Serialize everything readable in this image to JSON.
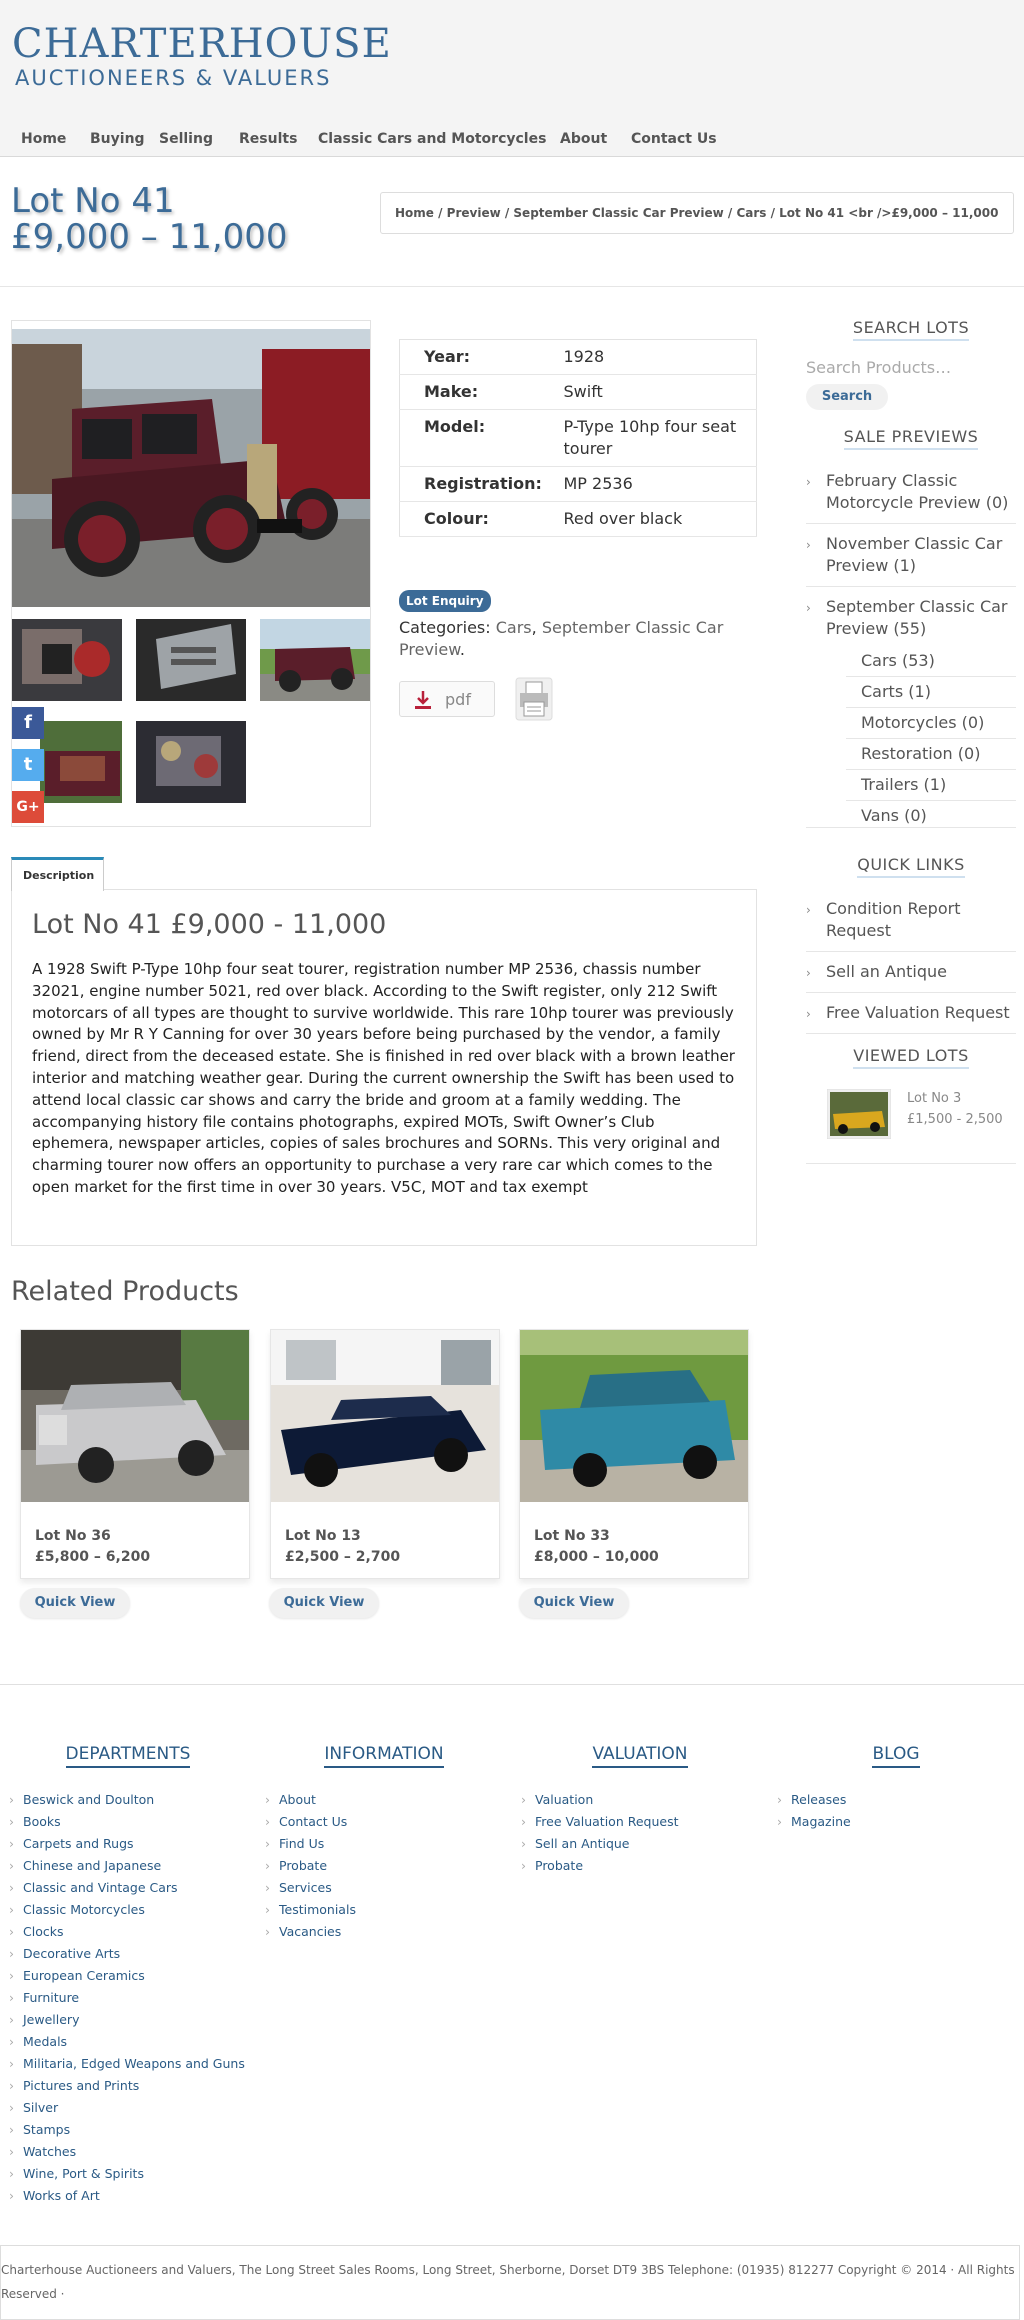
{
  "site": {
    "logo_line1": "CHARTERHOUSE",
    "logo_line2": "AUCTIONEERS & VALUERS",
    "brand_color": "#3c6b97"
  },
  "nav": [
    "Home",
    "Buying",
    "Selling",
    "Results",
    "Classic Cars and Motorcycles",
    "About",
    "Contact Us"
  ],
  "page": {
    "title_line1": "Lot No 41",
    "title_line2": "£9,000 – 11,000",
    "breadcrumb": "Home / Preview / September Classic Car Preview / Cars / Lot No 41 <br />£9,000 – 11,000"
  },
  "social": [
    {
      "icon": "facebook-icon",
      "glyph": "f",
      "color": "#3b5998"
    },
    {
      "icon": "twitter-icon",
      "glyph": "t",
      "color": "#55acee"
    },
    {
      "icon": "google-plus-icon",
      "glyph": "G+",
      "color": "#dd4b39"
    }
  ],
  "specs": [
    {
      "key": "Year:",
      "value": "1928"
    },
    {
      "key": "Make:",
      "value": "Swift"
    },
    {
      "key": "Model:",
      "value": "P-Type 10hp four seat tourer"
    },
    {
      "key": "Registration:",
      "value": "MP 2536"
    },
    {
      "key": "Colour:",
      "value": "Red over black"
    }
  ],
  "enquiry_label": "Lot Enquiry",
  "categories": {
    "label": "Categories:",
    "link1": "Cars",
    "separator": ",",
    "link2": "September Classic Car Preview",
    "end": "."
  },
  "pdf_label": "pdf",
  "description": {
    "tab_label": "Description",
    "heading": "Lot No 41 £9,000 - 11,000",
    "text": "A 1928 Swift P-Type 10hp four seat tourer, registration number MP 2536, chassis number 32021, engine number 5021, red over black. According to the Swift register, only 212 Swift motorcars of all types are thought to survive worldwide. This rare 10hp tourer was previously owned by Mr R Y Canning for over 30 years before being purchased by the vendor, a family friend, direct from the deceased estate. She is finished in red over black with a brown leather interior and matching weather gear. During the current ownership the Swift has been used to attend local classic car shows and carry the bride and groom at a family wedding. The accompanying history file contains photographs, expired MOTs, Swift Owner’s Club ephemera, newspaper articles, copies of sales brochures and SORNs. This very original and charming tourer now offers an opportunity to purchase a very rare car which comes to the open market for the first time in over 30 years. V5C, MOT and tax exempt"
  },
  "related": {
    "heading": "Related Products",
    "quick_view_label": "Quick View",
    "items": [
      {
        "lot": "Lot No 36",
        "price": "£5,800 – 6,200"
      },
      {
        "lot": "Lot No 13",
        "price": "£2,500 – 2,700"
      },
      {
        "lot": "Lot No 33",
        "price": "£8,000 – 10,000"
      }
    ]
  },
  "sidebar": {
    "search_heading": "SEARCH LOTS",
    "search_placeholder": "Search Products…",
    "search_button": "Search",
    "previews_heading": "SALE PREVIEWS",
    "previews": [
      {
        "name": "February Classic Motorcycle Preview",
        "count": "(0)"
      },
      {
        "name": "November Classic Car Preview",
        "count": "(1)"
      },
      {
        "name": "September Classic Car Preview",
        "count": "(55)"
      }
    ],
    "sub_previews": [
      {
        "name": "Cars",
        "count": "(53)"
      },
      {
        "name": "Carts",
        "count": "(1)"
      },
      {
        "name": "Motorcycles",
        "count": "(0)"
      },
      {
        "name": "Restoration",
        "count": "(0)"
      },
      {
        "name": "Trailers",
        "count": "(1)"
      },
      {
        "name": "Vans",
        "count": "(0)"
      }
    ],
    "quick_links_heading": "QUICK LINKS",
    "quick_links": [
      "Condition Report Request",
      "Sell an Antique",
      "Free Valuation Request"
    ],
    "viewed_heading": "VIEWED LOTS",
    "viewed": {
      "name": "Lot No 3",
      "price": "£1,500 - 2,500"
    }
  },
  "footer": {
    "departments_heading": "DEPARTMENTS",
    "departments": [
      "Beswick and Doulton",
      "Books",
      "Carpets and Rugs",
      "Chinese and Japanese",
      "Classic and Vintage Cars",
      "Classic Motorcycles",
      "Clocks",
      "Decorative Arts",
      "European Ceramics",
      "Furniture",
      "Jewellery",
      "Medals",
      "Militaria, Edged Weapons and Guns",
      "Pictures and Prints",
      "Silver",
      "Stamps",
      "Watches",
      "Wine, Port & Spirits",
      "Works of Art"
    ],
    "information_heading": "INFORMATION",
    "information": [
      "About",
      "Contact Us",
      "Find Us",
      "Probate",
      "Services",
      "Testimonials",
      "Vacancies"
    ],
    "valuation_heading": "VALUATION",
    "valuation": [
      "Valuation",
      "Free Valuation Request",
      "Sell an Antique",
      "Probate"
    ],
    "blog_heading": "BLOG",
    "blog": [
      "Releases",
      "Magazine"
    ],
    "copyright": "Charterhouse Auctioneers and Valuers, The Long Street Sales Rooms, Long Street, Sherborne, Dorset DT9 3BS Telephone: (01935) 812277 Copyright © 2014 · All Rights Reserved ·"
  }
}
